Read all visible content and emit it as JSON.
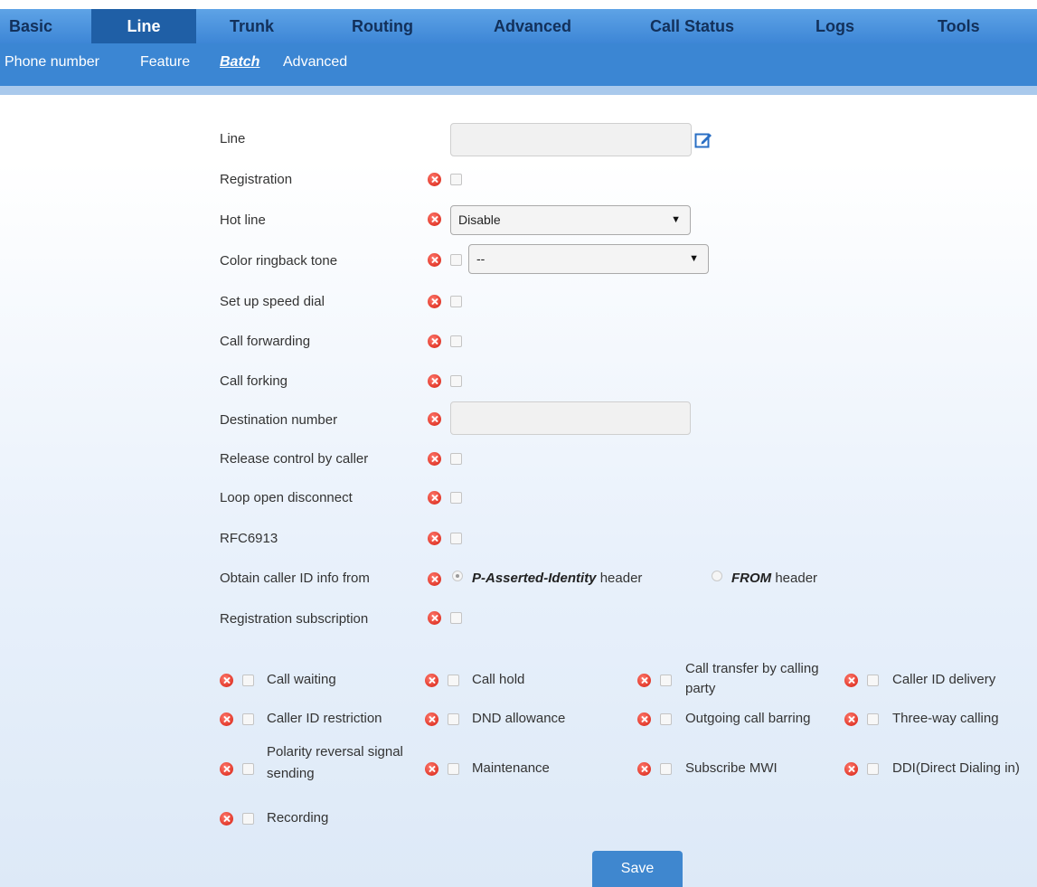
{
  "top_nav": {
    "tabs": [
      {
        "label": "Basic"
      },
      {
        "label": "Line"
      },
      {
        "label": "Trunk"
      },
      {
        "label": "Routing"
      },
      {
        "label": "Advanced"
      },
      {
        "label": "Call Status"
      },
      {
        "label": "Logs"
      },
      {
        "label": "Tools"
      }
    ],
    "active": "Line"
  },
  "sub_nav": {
    "tabs": [
      {
        "label": "Phone number"
      },
      {
        "label": "Feature"
      },
      {
        "label": "Batch"
      },
      {
        "label": "Advanced"
      }
    ],
    "active": "Batch"
  },
  "form": {
    "line_label": "Line",
    "line_value": "",
    "registration_label": "Registration",
    "hot_line_label": "Hot line",
    "hot_line_value": "Disable",
    "color_ringback_label": "Color ringback tone",
    "color_ringback_value": "--",
    "speed_dial_label": "Set up speed dial",
    "call_forwarding_label": "Call forwarding",
    "call_forking_label": "Call forking",
    "destination_label": "Destination number",
    "destination_value": "",
    "release_control_label": "Release control by caller",
    "loop_open_label": "Loop open disconnect",
    "rfc_label": "RFC6913",
    "caller_id_source_label": "Obtain caller ID info from",
    "caller_id_option1_bold": "P-Asserted-Identity",
    "caller_id_option1_suffix": "header",
    "caller_id_option2_bold": "FROM",
    "caller_id_option2_suffix": "header",
    "caller_id_selected": "P-Asserted-Identity",
    "reg_subscription_label": "Registration subscription"
  },
  "features": [
    {
      "label": "Call waiting"
    },
    {
      "label": "Call hold"
    },
    {
      "label": "Call transfer by calling party"
    },
    {
      "label": "Caller ID delivery"
    },
    {
      "label": "Caller ID restriction"
    },
    {
      "label": "DND allowance"
    },
    {
      "label": "Outgoing call barring"
    },
    {
      "label": "Three-way calling"
    },
    {
      "label": "Polarity reversal signal sending"
    },
    {
      "label": "Maintenance"
    },
    {
      "label": "Subscribe MWI"
    },
    {
      "label": "DDI(Direct Dialing in)"
    },
    {
      "label": "Recording"
    }
  ],
  "save_label": "Save",
  "colors": {
    "nav_blue": "#3b86d3",
    "active_tab": "#1f5fa6",
    "error_red": "#e23a2c"
  }
}
